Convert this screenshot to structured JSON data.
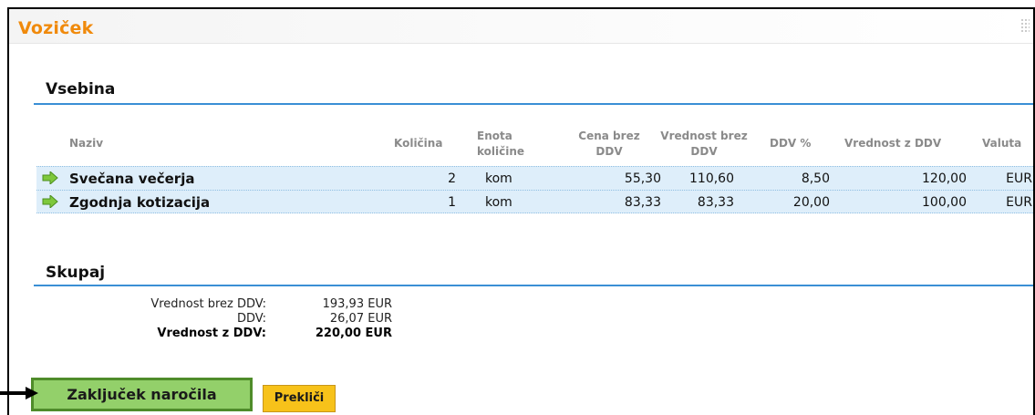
{
  "panel": {
    "title": "Voziček"
  },
  "contents": {
    "title": "Vsebina",
    "headers": {
      "name": "Naziv",
      "qty": "Količina",
      "unit_1": "Enota",
      "unit_2": "količine",
      "price_1": "Cena brez",
      "price_2": "DDV",
      "value_1": "Vrednost brez",
      "value_2": "DDV",
      "vat": "DDV %",
      "total": "Vrednost z DDV",
      "currency": "Valuta"
    },
    "rows": [
      {
        "name": "Svečana večerja",
        "qty": "2",
        "unit": "kom",
        "price": "55,30",
        "value": "110,60",
        "vat": "8,50",
        "total": "120,00",
        "currency": "EUR"
      },
      {
        "name": "Zgodnja kotizacija",
        "qty": "1",
        "unit": "kom",
        "price": "83,33",
        "value": "83,33",
        "vat": "20,00",
        "total": "100,00",
        "currency": "EUR"
      }
    ]
  },
  "summary": {
    "title": "Skupaj",
    "lines": [
      {
        "label": "Vrednost brez DDV:",
        "value": "193,93 EUR",
        "bold": false
      },
      {
        "label": "DDV:",
        "value": "26,07 EUR",
        "bold": false
      },
      {
        "label": "Vrednost z DDV:",
        "value": "220,00 EUR",
        "bold": true
      }
    ]
  },
  "actions": {
    "confirm_label": "Zaključek naročila",
    "cancel_label": "Prekliči"
  },
  "colors": {
    "title_orange": "#f08a0c",
    "accent_blue": "#3a8fd5",
    "row_bg": "#deeefa",
    "confirm_bg": "#93d06a",
    "cancel_bg": "#f7c21a"
  },
  "icons": {
    "row_icon": "green-arrow-right-icon",
    "pointer": "black-arrow-pointer-icon"
  }
}
